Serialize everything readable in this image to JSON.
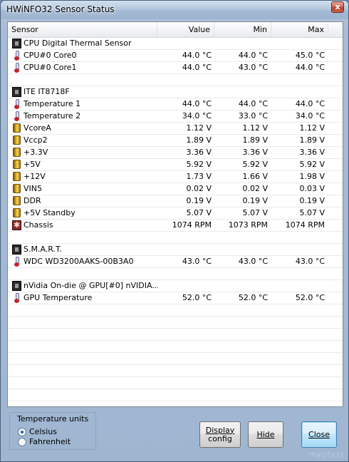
{
  "window": {
    "title": "HWiNFO32 Sensor Status",
    "close_glyph": "x"
  },
  "columns": {
    "sensor": "Sensor",
    "value": "Value",
    "min": "Min",
    "max": "Max"
  },
  "rows": [
    {
      "type": "group",
      "icon": "chip-icon",
      "name": "CPU Digital Thermal Sensor",
      "value": "",
      "min": "",
      "max": ""
    },
    {
      "type": "sensor",
      "icon": "thermometer-icon",
      "name": "CPU#0 Core0",
      "value": "44.0 °C",
      "min": "44.0 °C",
      "max": "45.0 °C"
    },
    {
      "type": "sensor",
      "icon": "thermometer-icon",
      "name": "CPU#0 Core1",
      "value": "44.0 °C",
      "min": "43.0 °C",
      "max": "44.0 °C"
    },
    {
      "type": "blank",
      "name": "",
      "value": "",
      "min": "",
      "max": ""
    },
    {
      "type": "group",
      "icon": "chip-icon",
      "name": "ITE IT8718F",
      "value": "",
      "min": "",
      "max": ""
    },
    {
      "type": "sensor",
      "icon": "thermometer-icon",
      "name": "Temperature 1",
      "value": "44.0 °C",
      "min": "44.0 °C",
      "max": "44.0 °C"
    },
    {
      "type": "sensor",
      "icon": "thermometer-icon",
      "name": "Temperature 2",
      "value": "34.0 °C",
      "min": "33.0 °C",
      "max": "34.0 °C"
    },
    {
      "type": "sensor",
      "icon": "voltage-icon",
      "name": "VcoreA",
      "value": "1.12 V",
      "min": "1.12 V",
      "max": "1.12 V"
    },
    {
      "type": "sensor",
      "icon": "voltage-icon",
      "name": "Vccp2",
      "value": "1.89 V",
      "min": "1.89 V",
      "max": "1.89 V"
    },
    {
      "type": "sensor",
      "icon": "voltage-icon",
      "name": "+3.3V",
      "value": "3.36 V",
      "min": "3.36 V",
      "max": "3.36 V"
    },
    {
      "type": "sensor",
      "icon": "voltage-icon",
      "name": "+5V",
      "value": "5.92 V",
      "min": "5.92 V",
      "max": "5.92 V"
    },
    {
      "type": "sensor",
      "icon": "voltage-icon",
      "name": "+12V",
      "value": "1.73 V",
      "min": "1.66 V",
      "max": "1.98 V"
    },
    {
      "type": "sensor",
      "icon": "voltage-icon",
      "name": "VIN5",
      "value": "0.02 V",
      "min": "0.02 V",
      "max": "0.03 V"
    },
    {
      "type": "sensor",
      "icon": "voltage-icon",
      "name": "DDR",
      "value": "0.19 V",
      "min": "0.19 V",
      "max": "0.19 V"
    },
    {
      "type": "sensor",
      "icon": "voltage-icon",
      "name": "+5V Standby",
      "value": "5.07 V",
      "min": "5.07 V",
      "max": "5.07 V"
    },
    {
      "type": "sensor",
      "icon": "fan-icon",
      "name": "Chassis",
      "value": "1074 RPM",
      "min": "1073 RPM",
      "max": "1074 RPM"
    },
    {
      "type": "blank",
      "name": "",
      "value": "",
      "min": "",
      "max": ""
    },
    {
      "type": "group",
      "icon": "chip-icon",
      "name": "S.M.A.R.T.",
      "value": "",
      "min": "",
      "max": ""
    },
    {
      "type": "sensor",
      "icon": "thermometer-icon",
      "name": "WDC WD3200AAKS-00B3A0",
      "value": "43.0 °C",
      "min": "43.0 °C",
      "max": "43.0 °C"
    },
    {
      "type": "blank",
      "name": "",
      "value": "",
      "min": "",
      "max": ""
    },
    {
      "type": "group",
      "icon": "chip-icon",
      "name": "nVidia On-die @ GPU[#0] nVIDIA...",
      "value": "",
      "min": "",
      "max": ""
    },
    {
      "type": "sensor",
      "icon": "thermometer-icon",
      "name": "GPU Temperature",
      "value": "52.0 °C",
      "min": "52.0 °C",
      "max": "52.0 °C"
    },
    {
      "type": "blank",
      "name": "",
      "value": "",
      "min": "",
      "max": ""
    },
    {
      "type": "blank",
      "name": "",
      "value": "",
      "min": "",
      "max": ""
    },
    {
      "type": "blank",
      "name": "",
      "value": "",
      "min": "",
      "max": ""
    },
    {
      "type": "blank",
      "name": "",
      "value": "",
      "min": "",
      "max": ""
    },
    {
      "type": "blank",
      "name": "",
      "value": "",
      "min": "",
      "max": ""
    },
    {
      "type": "blank",
      "name": "",
      "value": "",
      "min": "",
      "max": ""
    },
    {
      "type": "blank",
      "name": "",
      "value": "",
      "min": "",
      "max": ""
    },
    {
      "type": "blank",
      "name": "",
      "value": "",
      "min": "",
      "max": ""
    },
    {
      "type": "blank",
      "name": "",
      "value": "",
      "min": "",
      "max": ""
    }
  ],
  "temperature_units": {
    "title": "Temperature units",
    "options": [
      {
        "label": "Celsius",
        "selected": true
      },
      {
        "label": "Fahrenheit",
        "selected": false
      }
    ]
  },
  "buttons": {
    "display_config_line1": "Display",
    "display_config_line2": "config",
    "hide": "Hide",
    "close": "Close"
  },
  "watermark": "mycity.rs"
}
